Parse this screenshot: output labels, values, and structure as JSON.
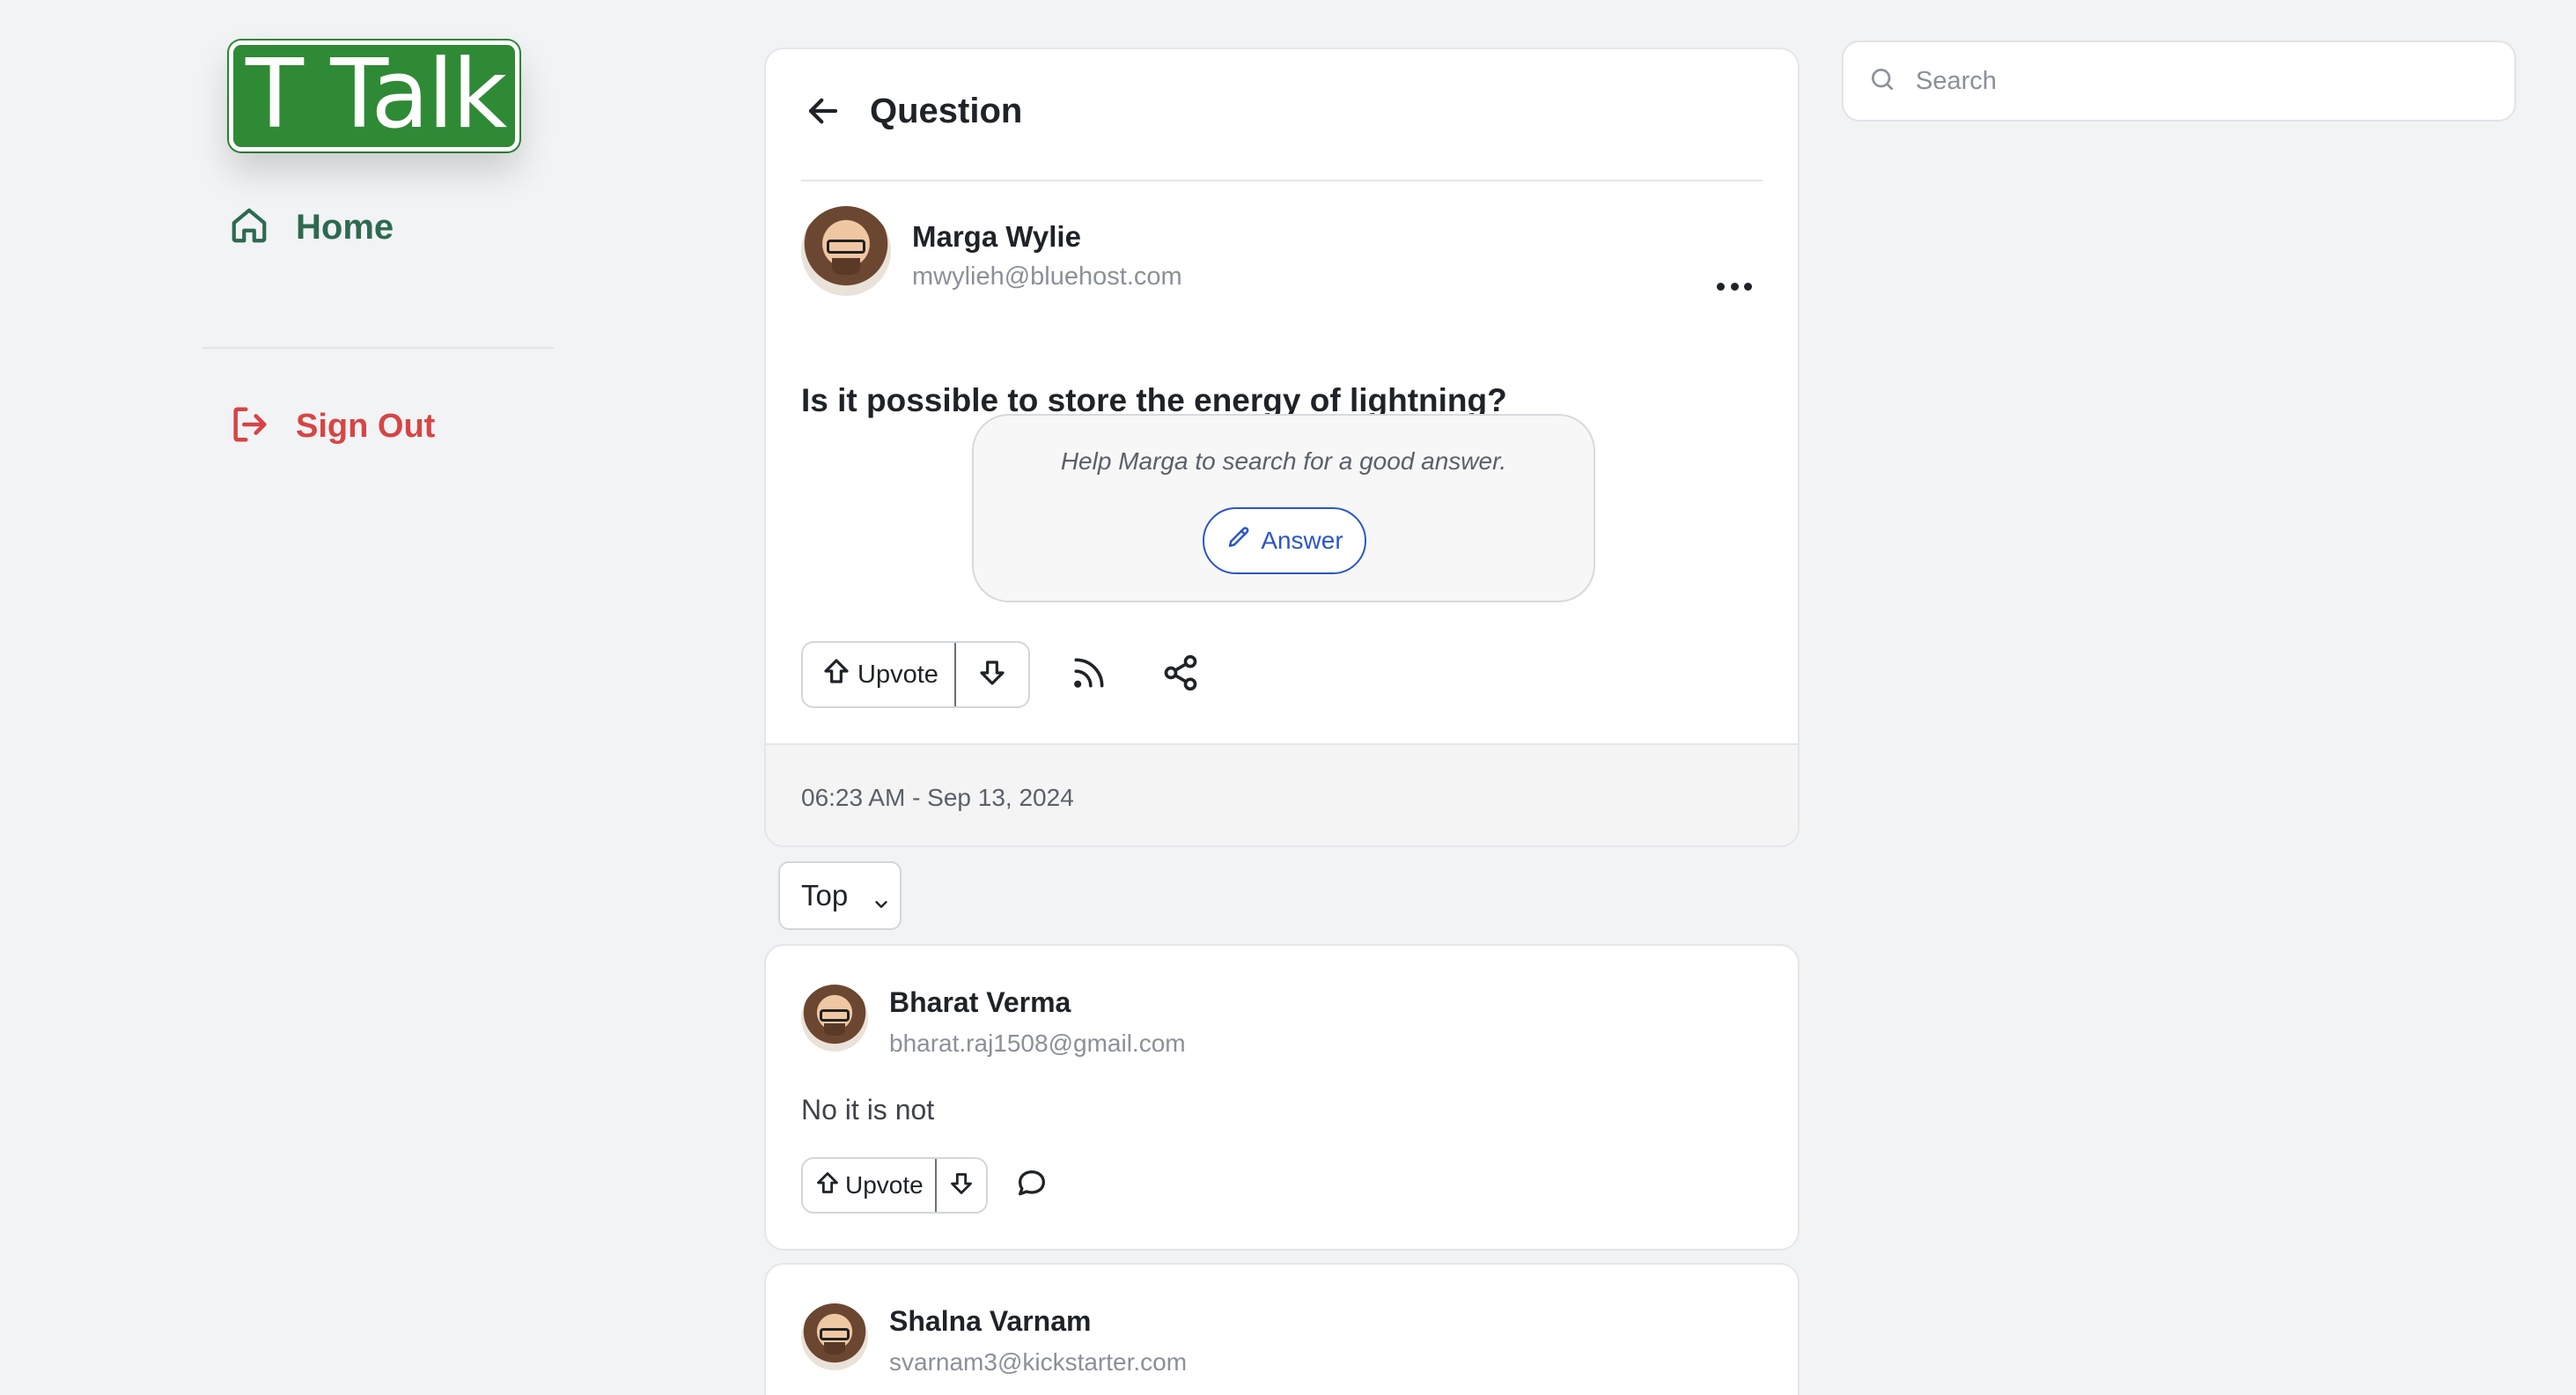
{
  "app": {
    "logo_text": "T Talk"
  },
  "sidebar": {
    "home_label": "Home",
    "signout_label": "Sign Out",
    "home_icon": "home-icon",
    "signout_icon": "sign-out-icon"
  },
  "search": {
    "placeholder": "Search",
    "value": ""
  },
  "question": {
    "header_title": "Question",
    "author": {
      "name": "Marga Wylie",
      "email": "mwylieh@bluehost.com"
    },
    "text": "Is it possible to store the energy of lightning?",
    "help_text": "Help Marga to search for a good answer.",
    "answer_button_label": "Answer",
    "upvote_label": "Upvote",
    "timestamp": "06:23 AM - Sep 13, 2024"
  },
  "sort": {
    "selected": "Top"
  },
  "answers": [
    {
      "author": {
        "name": "Bharat Verma",
        "email": "bharat.raj1508@gmail.com"
      },
      "text": "No it is not",
      "upvote_label": "Upvote"
    },
    {
      "author": {
        "name": "Shalna Varnam",
        "email": "svarnam3@kickstarter.com"
      }
    }
  ],
  "colors": {
    "brand_green": "#2f8a35",
    "home_green": "#2d6a4f",
    "signout_red": "#d64545",
    "link_blue": "#2a56c6",
    "background": "#f2f3f5"
  }
}
